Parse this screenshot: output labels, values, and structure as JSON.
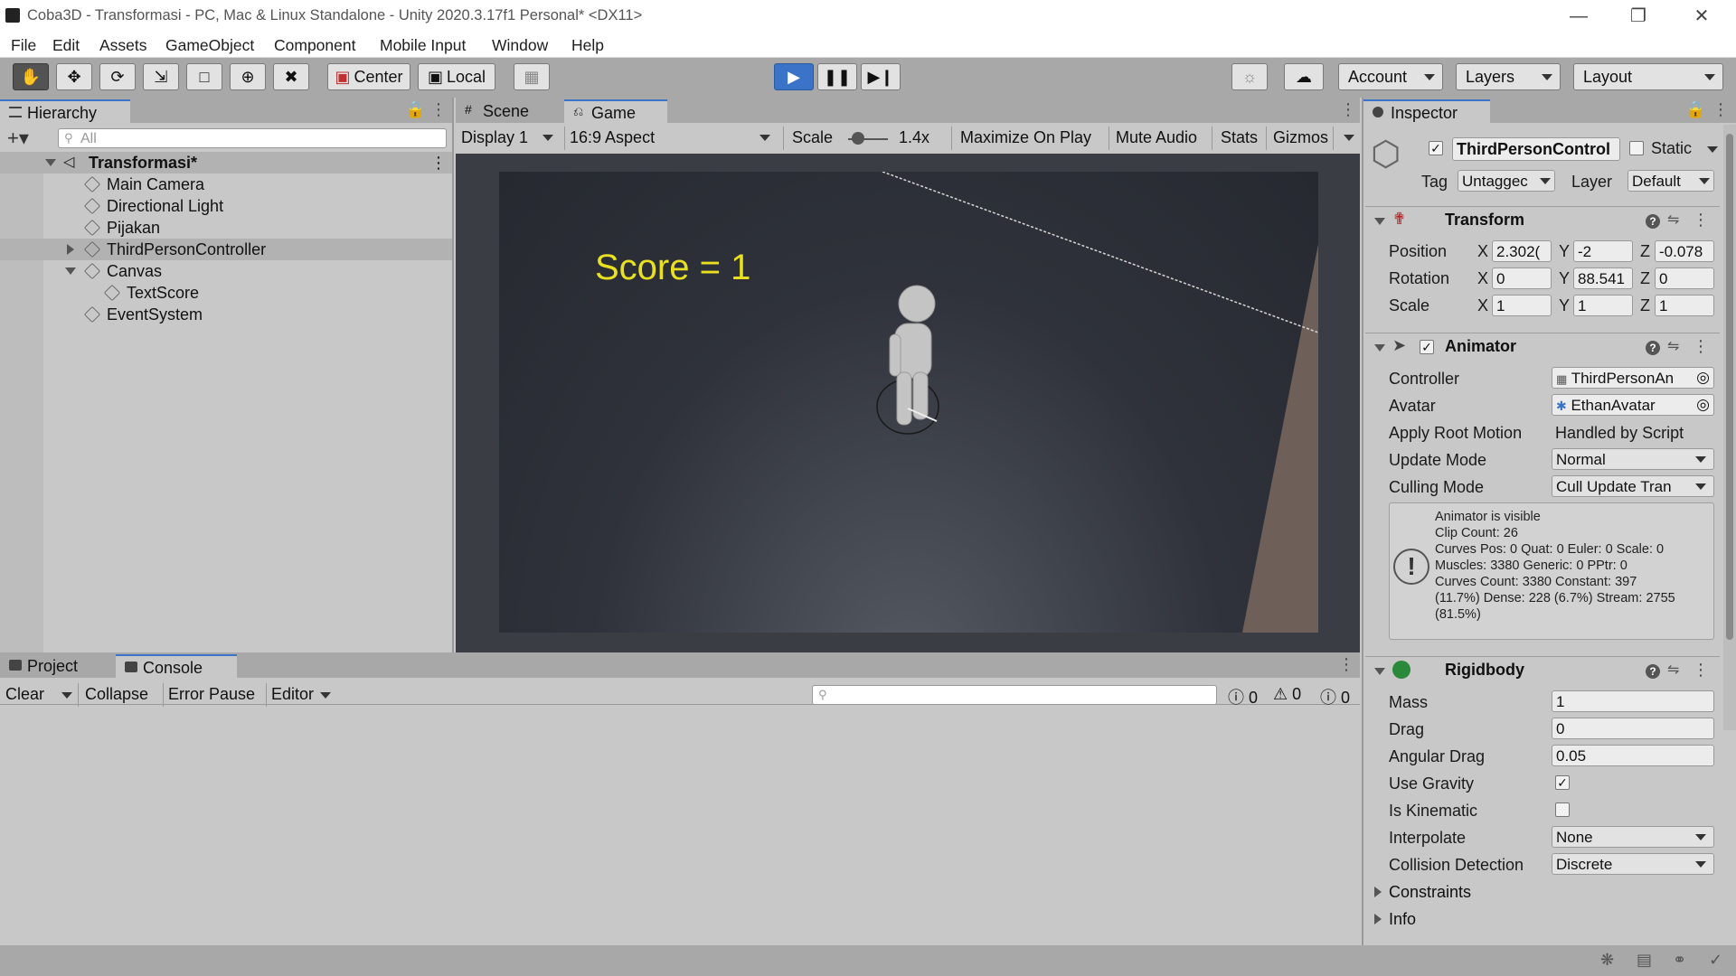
{
  "window": {
    "title": "Coba3D - Transformasi - PC, Mac & Linux Standalone - Unity 2020.3.17f1 Personal* <DX11>"
  },
  "menu": [
    "File",
    "Edit",
    "Assets",
    "GameObject",
    "Component",
    "Mobile Input",
    "Window",
    "Help"
  ],
  "toolbar": {
    "center_label": "Center",
    "local_label": "Local",
    "account_label": "Account",
    "layers_label": "Layers",
    "layout_label": "Layout"
  },
  "hierarchy": {
    "tab_label": "Hierarchy",
    "search_placeholder": "All",
    "scene_name": "Transformasi*",
    "items": [
      "Main Camera",
      "Directional Light",
      "Pijakan",
      "ThirdPersonController",
      "Canvas",
      "TextScore",
      "EventSystem"
    ]
  },
  "game_view": {
    "tabs": [
      "Scene",
      "Game"
    ],
    "display": "Display 1",
    "aspect": "16:9 Aspect",
    "scale_label": "Scale",
    "scale_value": "1.4x",
    "maximize": "Maximize On Play",
    "mute": "Mute Audio",
    "stats": "Stats",
    "gizmos": "Gizmos",
    "score_text": "Score = 1",
    "colors": {
      "score": "#e8e020",
      "floor": "#2e3138",
      "wall": "#6e6058"
    }
  },
  "bottom": {
    "tabs": [
      "Project",
      "Console"
    ],
    "clear": "Clear",
    "collapse": "Collapse",
    "error_pause": "Error Pause",
    "editor": "Editor",
    "count_errors": "0",
    "count_warnings": "0",
    "count_logs": "0"
  },
  "inspector": {
    "tab_label": "Inspector",
    "object_name": "ThirdPersonControl",
    "static_label": "Static",
    "tag_label": "Tag",
    "tag_value": "Untaggec",
    "layer_label": "Layer",
    "layer_value": "Default",
    "transform": {
      "title": "Transform",
      "position_label": "Position",
      "rotation_label": "Rotation",
      "scale_label": "Scale",
      "x": "X",
      "y": "Y",
      "z": "Z",
      "position": [
        "2.302(",
        "-2",
        "-0.078"
      ],
      "rotation": [
        "0",
        "88.541",
        "0"
      ],
      "scale": [
        "1",
        "1",
        "1"
      ]
    },
    "animator": {
      "title": "Animator",
      "controller_label": "Controller",
      "controller_value": "ThirdPersonAn",
      "avatar_label": "Avatar",
      "avatar_value": "EthanAvatar",
      "apply_root_label": "Apply Root Motion",
      "apply_root_value": "Handled by Script",
      "update_mode_label": "Update Mode",
      "update_mode_value": "Normal",
      "culling_label": "Culling Mode",
      "culling_value": "Cull Update Tran",
      "info_lines": [
        "Animator is visible",
        "Clip Count: 26",
        "Curves Pos: 0 Quat: 0 Euler: 0 Scale: 0",
        "Muscles: 3380 Generic: 0 PPtr: 0",
        "Curves Count: 3380 Constant: 397",
        "(11.7%) Dense: 228 (6.7%) Stream: 2755",
        "(81.5%)"
      ]
    },
    "rigidbody": {
      "title": "Rigidbody",
      "mass_label": "Mass",
      "mass": "1",
      "drag_label": "Drag",
      "drag": "0",
      "angular_label": "Angular Drag",
      "angular": "0.05",
      "gravity_label": "Use Gravity",
      "gravity": true,
      "kinematic_label": "Is Kinematic",
      "kinematic": false,
      "interpolate_label": "Interpolate",
      "interpolate": "None",
      "collision_label": "Collision Detection",
      "collision": "Discrete",
      "constraints_label": "Constraints",
      "info_label": "Info"
    }
  }
}
